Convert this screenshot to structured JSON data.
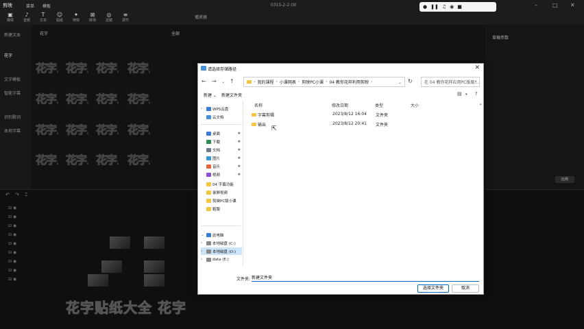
{
  "app": {
    "logo": "剪映",
    "window_title": "0315-2-2 (9)",
    "menu": [
      "菜单",
      "模板"
    ],
    "toolbar": [
      {
        "icon": "media-icon",
        "glyph": "▣",
        "label": "媒体"
      },
      {
        "icon": "audio-icon",
        "glyph": "♪",
        "label": "音频"
      },
      {
        "icon": "text-icon",
        "glyph": "T",
        "label": "文本"
      },
      {
        "icon": "sticker-icon",
        "glyph": "☺",
        "label": "贴纸"
      },
      {
        "icon": "effects-icon",
        "glyph": "✦",
        "label": "特效"
      },
      {
        "icon": "transition-icon",
        "glyph": "⊠",
        "label": "转场"
      },
      {
        "icon": "filter-icon",
        "glyph": "◎",
        "label": "滤镜"
      },
      {
        "icon": "adjust-icon",
        "glyph": "≡",
        "label": "调节"
      }
    ],
    "left_categories": [
      "新建文本",
      "花字",
      "文字模板",
      "智能字幕",
      "识别歌词",
      "本地字幕"
    ],
    "panel_label": "花字",
    "all_label": "全部",
    "preview_label": "播放器",
    "right_panel_label": "草稿参数",
    "ratio_label": "比例",
    "asset_text": "花字",
    "big_timeline_text": "花字贴纸大全 花字",
    "record_widget_icons": [
      "record-icon",
      "pause-icon",
      "mic-icon",
      "camera-icon",
      "stop-icon"
    ]
  },
  "dialog": {
    "title": "请选择存储路径",
    "close_label": "✕",
    "nav": {
      "back": "←",
      "forward": "→",
      "up_menu": "⌄",
      "up": "↑",
      "refresh": "↻"
    },
    "breadcrumb": [
      "我的课程",
      "小课网表",
      "剪映PC小课",
      "04 教你花样利用剪映"
    ],
    "search_placeholder": "在 04 教你花样应用PC版度…",
    "commands": {
      "new": "新建",
      "new_folder": "新建文件夹",
      "view": "▤",
      "more": "⋯",
      "help": "?"
    },
    "nav_items": [
      {
        "label": "WPS云盘",
        "icon": "wps-cloud-icon",
        "color": "#3a7bd5",
        "chev": "›",
        "pinned": false
      },
      {
        "label": "云文档",
        "icon": "cloud-docs-icon",
        "color": "#4a90d9",
        "chev": "",
        "pinned": false
      },
      {
        "label": "桌面",
        "icon": "desktop-icon",
        "color": "#3a7bd5",
        "chev": "",
        "pinned": true
      },
      {
        "label": "下载",
        "icon": "download-icon",
        "color": "#2e8b57",
        "chev": "",
        "pinned": true
      },
      {
        "label": "文档",
        "icon": "documents-icon",
        "color": "#6c7a89",
        "chev": "",
        "pinned": true
      },
      {
        "label": "图片",
        "icon": "pictures-icon",
        "color": "#3a9ad9",
        "chev": "",
        "pinned": true
      },
      {
        "label": "音乐",
        "icon": "music-icon",
        "color": "#e8643c",
        "chev": "",
        "pinned": true
      },
      {
        "label": "视频",
        "icon": "videos-icon",
        "color": "#8a4fd8",
        "chev": "",
        "pinned": true
      },
      {
        "label": "04 字幕功能",
        "icon": "folder-icon",
        "color": "#f4c542",
        "chev": "",
        "pinned": false
      },
      {
        "label": "录屏视频",
        "icon": "folder-icon",
        "color": "#f4c542",
        "chev": "",
        "pinned": false
      },
      {
        "label": "剪映PC版小课",
        "icon": "folder-icon",
        "color": "#f4c542",
        "chev": "",
        "pinned": false
      },
      {
        "label": "鞋服",
        "icon": "folder-icon",
        "color": "#f4c542",
        "chev": "",
        "pinned": false
      },
      {
        "label": "此电脑",
        "icon": "this-pc-icon",
        "color": "#3a7bd5",
        "chev": "⌄",
        "pinned": false
      },
      {
        "label": "本地磁盘 (C:)",
        "icon": "drive-icon",
        "color": "#8a8a8a",
        "chev": "›",
        "pinned": false
      },
      {
        "label": "本地磁盘 (D:)",
        "icon": "drive-icon",
        "color": "#8a8a8a",
        "chev": "›",
        "pinned": false
      },
      {
        "label": "data (E:)",
        "icon": "drive-icon",
        "color": "#8a8a8a",
        "chev": "›",
        "pinned": false
      }
    ],
    "columns": [
      "名称",
      "修改日期",
      "类型",
      "大小"
    ],
    "files": [
      {
        "name": "字幕剪辑",
        "date": "2023/8/12 16:04",
        "type": "文件夹",
        "size": ""
      },
      {
        "name": "输出",
        "date": "2023/8/12 20:41",
        "type": "文件夹",
        "size": ""
      }
    ],
    "filename_label": "文件夹:",
    "filename_value": "新建文件夹",
    "select_button": "选择文件夹",
    "cancel_button": "取消"
  }
}
